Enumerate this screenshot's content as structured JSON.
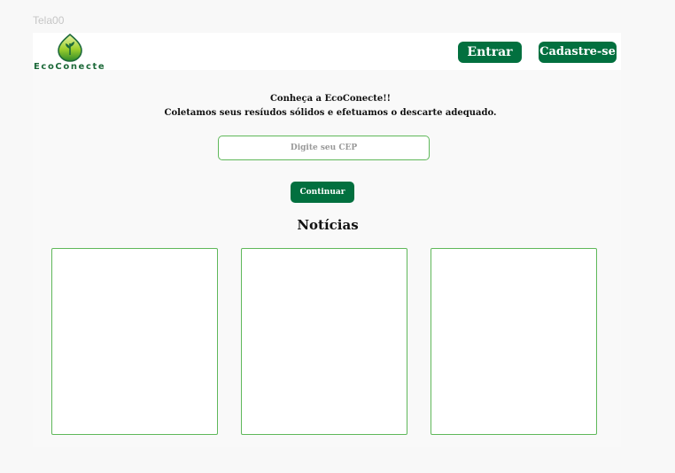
{
  "frame_label": "Tela00",
  "header": {
    "logo_text": "EcoConecte",
    "login_label": "Entrar",
    "signup_label": "Cadastre-se"
  },
  "intro": {
    "line1": "Conheça a EcoConecte!!",
    "line2": "Coletamos  seus resíudos sólidos e efetuamos o descarte adequado."
  },
  "cep": {
    "placeholder": "Digite seu CEP",
    "value": ""
  },
  "continue_label": "Continuar",
  "news": {
    "title": "Notícias",
    "card_count": 3
  },
  "colors": {
    "brand_green": "#02703f",
    "border_green": "#5fb85a",
    "leaf_green": "#1d6a3a"
  }
}
